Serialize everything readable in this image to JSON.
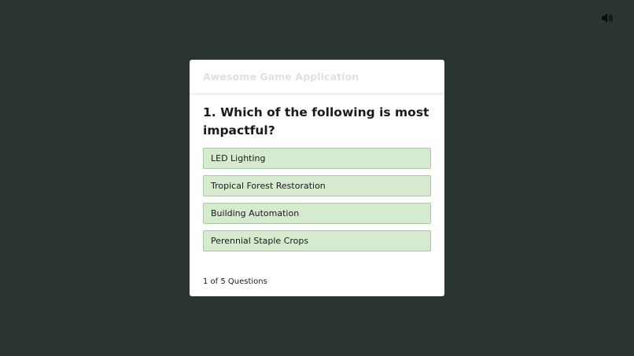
{
  "icons": {
    "sound": "speaker-volume-icon"
  },
  "colors": {
    "background": "#2a3530",
    "option_fill": "#d6ead0",
    "option_border": "#a9c9a0",
    "title_muted": "#e2e0da"
  },
  "header": {
    "title": "Awesome Game Application"
  },
  "quiz": {
    "question": "1. Which of the following is most impactful?",
    "options": [
      "LED Lighting",
      "Tropical Forest Restoration",
      "Building Automation",
      "Perennial Staple Crops"
    ],
    "progress": "1 of 5 Questions"
  }
}
